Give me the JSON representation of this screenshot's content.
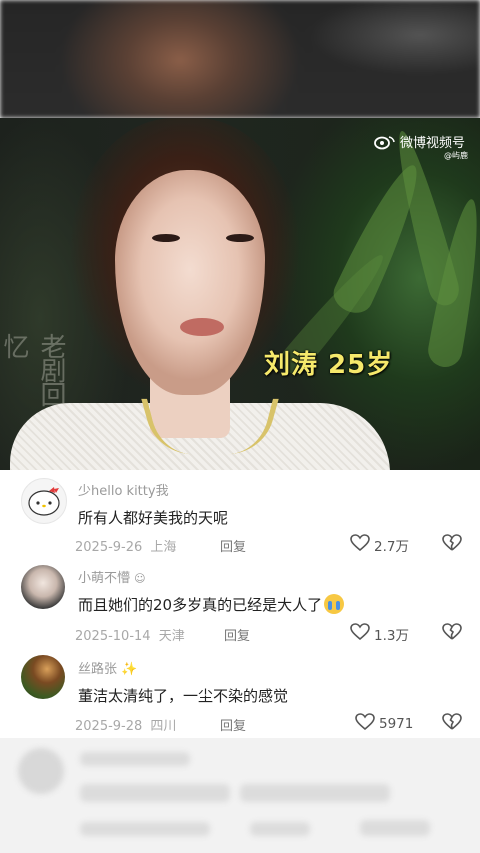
{
  "video": {
    "caption": "刘涛 25岁",
    "watermark_text": "微博视频号",
    "watermark_sub": "@屿鹿",
    "left_calligraphy": "老剧回忆"
  },
  "comments": [
    {
      "username": "少hello kitty我",
      "content": "所有人都好美我的天呢",
      "date": "2025-9-26",
      "location": "上海",
      "reply_label": "回复",
      "likes": "2.7万"
    },
    {
      "username": "小萌不懵",
      "content": "而且她们的20多岁真的已经是大人了",
      "date": "2025-10-14",
      "location": "天津",
      "reply_label": "回复",
      "likes": "1.3万"
    },
    {
      "username": "丝路张",
      "content": "董洁太清纯了，一尘不染的感觉",
      "date": "2025-9-28",
      "location": "四川",
      "reply_label": "回复",
      "likes": "5971"
    }
  ],
  "colors": {
    "caption": "#f6e96b",
    "username": "#9a9a9a",
    "meta": "#a8a8a8",
    "text": "#222222"
  }
}
